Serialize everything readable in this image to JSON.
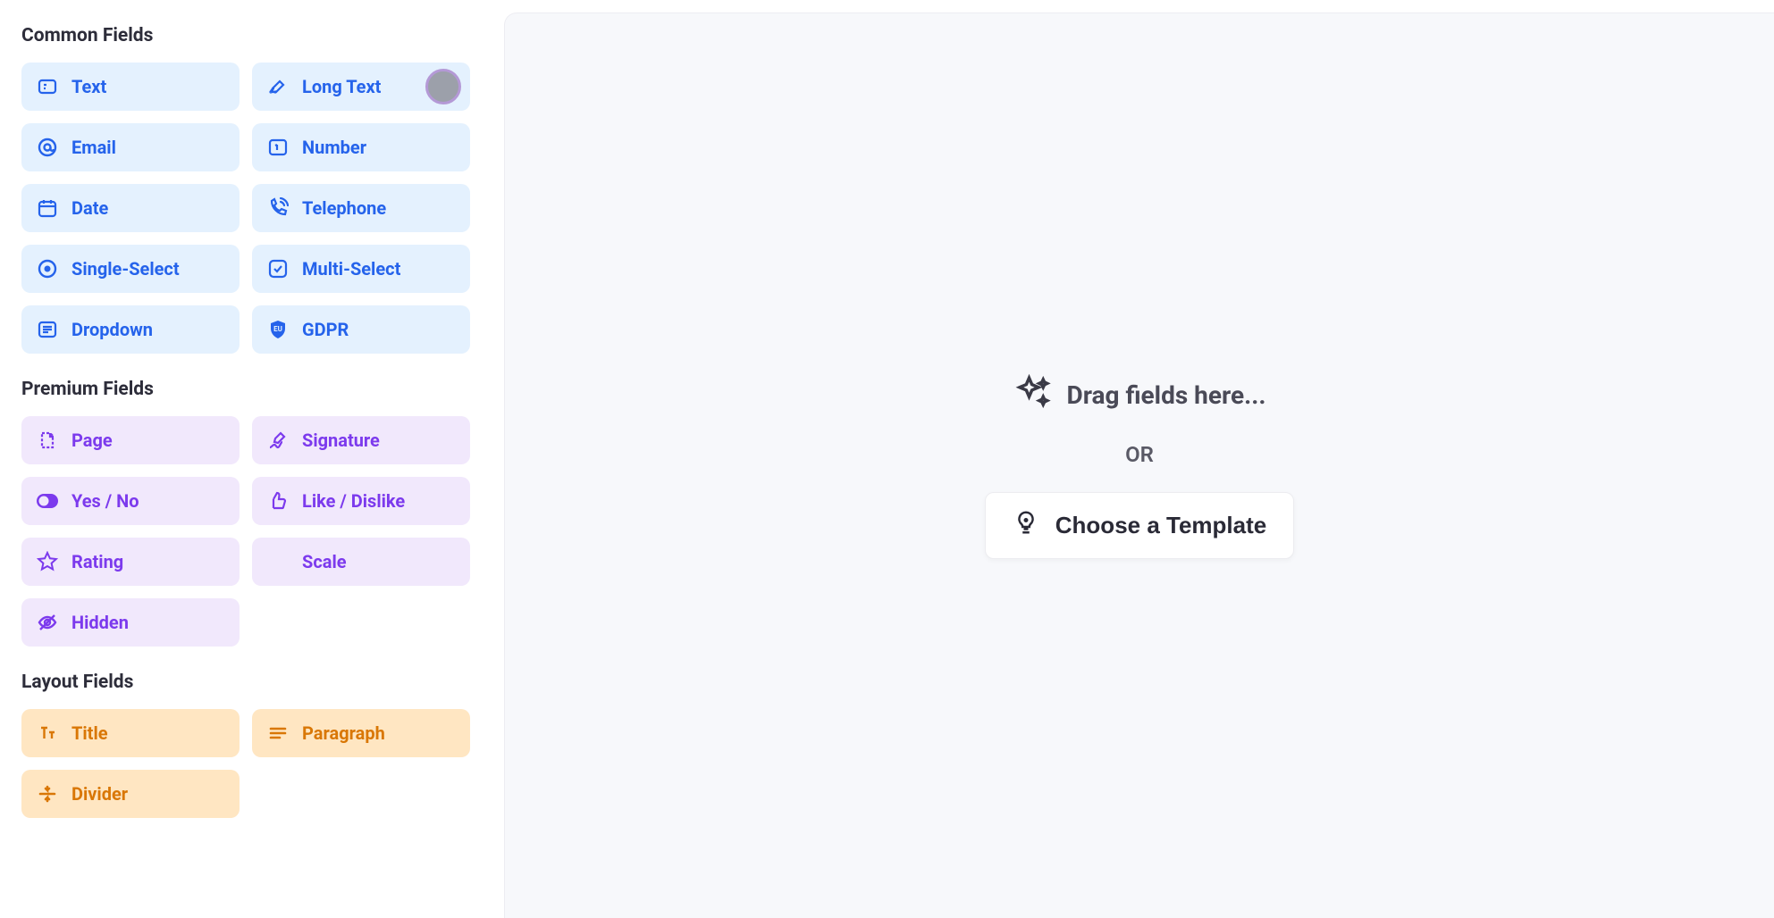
{
  "sections": {
    "common": {
      "heading": "Common Fields",
      "fields": [
        {
          "key": "text",
          "label": "Text",
          "icon": "text-icon"
        },
        {
          "key": "long-text",
          "label": "Long Text",
          "icon": "long-text-icon",
          "highlighted": true
        },
        {
          "key": "email",
          "label": "Email",
          "icon": "email-icon"
        },
        {
          "key": "number",
          "label": "Number",
          "icon": "number-icon"
        },
        {
          "key": "date",
          "label": "Date",
          "icon": "date-icon"
        },
        {
          "key": "telephone",
          "label": "Telephone",
          "icon": "telephone-icon"
        },
        {
          "key": "single-select",
          "label": "Single-Select",
          "icon": "single-select-icon"
        },
        {
          "key": "multi-select",
          "label": "Multi-Select",
          "icon": "multi-select-icon"
        },
        {
          "key": "dropdown",
          "label": "Dropdown",
          "icon": "dropdown-icon"
        },
        {
          "key": "gdpr",
          "label": "GDPR",
          "icon": "gdpr-icon"
        }
      ]
    },
    "premium": {
      "heading": "Premium Fields",
      "fields": [
        {
          "key": "page",
          "label": "Page",
          "icon": "page-icon"
        },
        {
          "key": "signature",
          "label": "Signature",
          "icon": "signature-icon"
        },
        {
          "key": "yes-no",
          "label": "Yes / No",
          "icon": "toggle-icon"
        },
        {
          "key": "like-dislike",
          "label": "Like / Dislike",
          "icon": "thumbs-up-icon"
        },
        {
          "key": "rating",
          "label": "Rating",
          "icon": "star-icon"
        },
        {
          "key": "scale",
          "label": "Scale",
          "icon": "scale-icon"
        },
        {
          "key": "hidden",
          "label": "Hidden",
          "icon": "hidden-icon"
        }
      ]
    },
    "layout": {
      "heading": "Layout Fields",
      "fields": [
        {
          "key": "title",
          "label": "Title",
          "icon": "title-icon"
        },
        {
          "key": "paragraph",
          "label": "Paragraph",
          "icon": "paragraph-icon"
        },
        {
          "key": "divider",
          "label": "Divider",
          "icon": "divider-icon"
        }
      ]
    }
  },
  "canvas": {
    "drag_hint": "Drag fields here...",
    "or": "OR",
    "template_button": "Choose a Template"
  },
  "colors": {
    "common_bg": "#e4f1fe",
    "common_fg": "#2563eb",
    "premium_bg": "#f1e8fc",
    "premium_fg": "#7c3aed",
    "layout_bg": "#ffe6c2",
    "layout_fg": "#d97706",
    "canvas_bg": "#f7f8fb"
  }
}
